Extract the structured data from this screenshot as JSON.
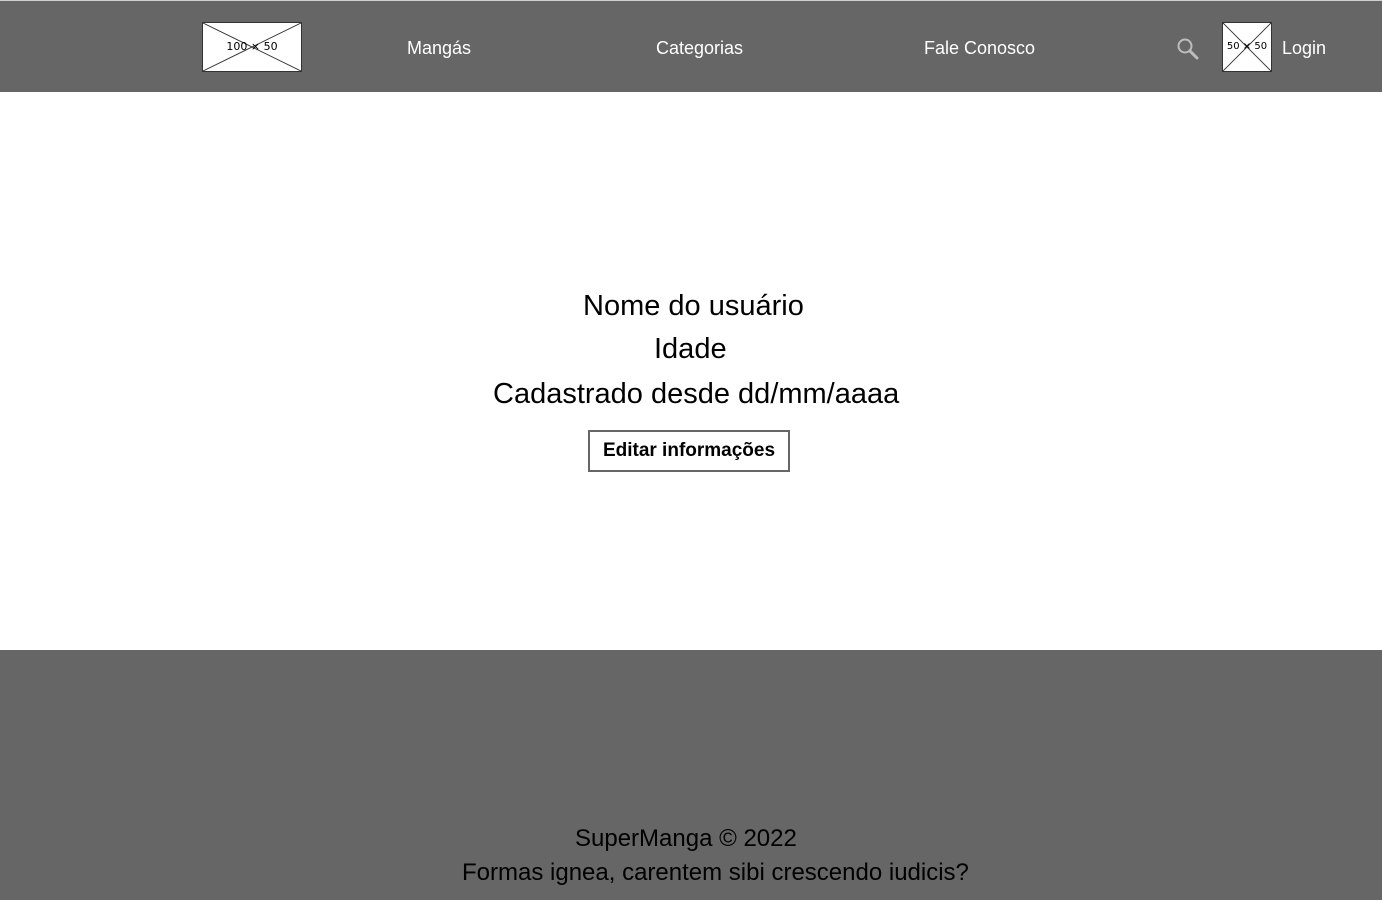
{
  "header": {
    "logo_placeholder": "100 × 50",
    "nav": {
      "mangas": "Mangás",
      "categorias": "Categorias",
      "fale_conosco": "Fale Conosco"
    },
    "search_icon": "search-icon",
    "avatar_placeholder": "50 × 50",
    "login": "Login"
  },
  "profile": {
    "name": "Nome do usuário",
    "age": "Idade",
    "registered_since": "Cadastrado desde dd/mm/aaaa",
    "edit_button": "Editar informações"
  },
  "footer": {
    "copyright": "SuperManga © 2022",
    "tagline": "Formas ignea, carentem sibi crescendo iudicis?"
  },
  "colors": {
    "header_bg": "#666666",
    "footer_bg": "#666666",
    "nav_text": "#ffffff",
    "body_bg": "#ffffff"
  }
}
